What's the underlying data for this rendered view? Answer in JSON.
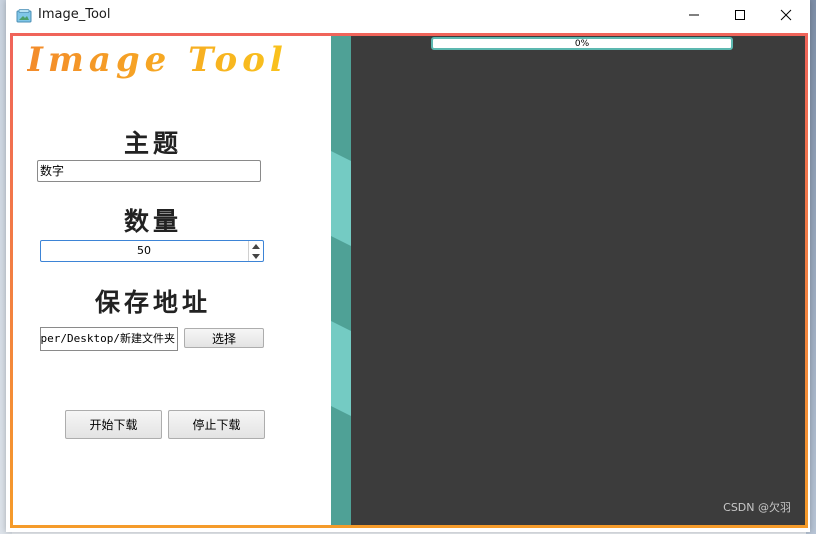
{
  "window": {
    "title": "Image_Tool",
    "icon": "app-window-icon"
  },
  "left_panel": {
    "logo": "Image Tool",
    "topic": {
      "heading": "主题",
      "value": "数字"
    },
    "quantity": {
      "heading": "数量",
      "value": "50"
    },
    "save_path": {
      "heading": "保存地址",
      "value": "C:/Users/Admin/Desktop/新建文件夹",
      "visible_text": "per/Desktop/新建文件夹",
      "choose_label": "选择"
    },
    "actions": {
      "start_label": "开始下载",
      "stop_label": "停止下载"
    }
  },
  "right_panel": {
    "progress_label": "0%",
    "progress_value": 0
  },
  "watermark": "CSDN @欠羽",
  "colors": {
    "border_top": "#f0645a",
    "border_bottom": "#f59b2a",
    "separator": "#4fa196",
    "accent": "#5cb8b0",
    "dark_panel": "#3c3c3c",
    "logo_gradient_start": "#f38b2b",
    "logo_gradient_end": "#f9c31c"
  }
}
